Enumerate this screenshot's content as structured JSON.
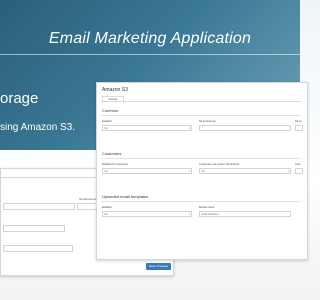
{
  "banner": {
    "title": "Email Marketing Application",
    "headline_fragment": "orage",
    "subtext_fragment": "sing Amazon S3."
  },
  "front_window": {
    "title": "Amazon S3",
    "tab_label": "Settings",
    "sections": {
      "common": {
        "heading": "Common",
        "fields": [
          {
            "label": "Enabled",
            "value": "Yes"
          },
          {
            "label": "S3 access key",
            "value": ""
          },
          {
            "label": "S3 se",
            "value": ""
          }
        ]
      },
      "customers": {
        "heading": "Customers",
        "fields": [
          {
            "label": "Enabled for customers",
            "value": "Yes"
          },
          {
            "label": "Customers use system S3 account",
            "value": "Yes"
          },
          {
            "label": "Cust",
            "value": ""
          }
        ]
      },
      "uploaded": {
        "heading": "Uploaded email templates",
        "fields": [
          {
            "label": "Enabled",
            "value": "Yes"
          },
          {
            "label": "Bucket name",
            "value": "yourbucketname"
          }
        ]
      }
    }
  },
  "back_window": {
    "field_label": "S3 access key",
    "save_label": "Save changes"
  }
}
